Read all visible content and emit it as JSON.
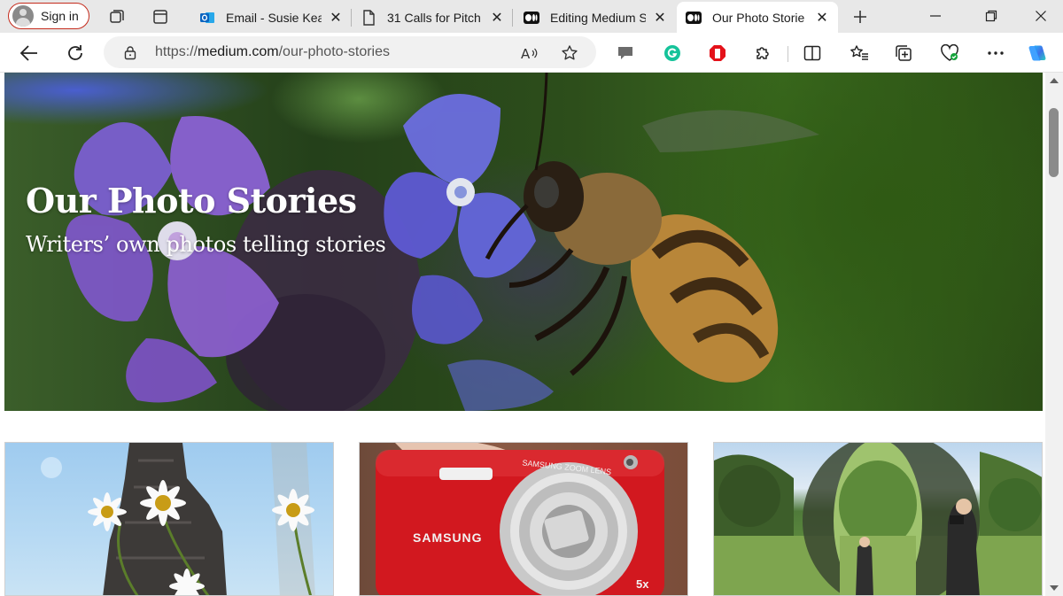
{
  "browser": {
    "profile": {
      "label": "Sign in"
    },
    "tabs": [
      {
        "title": "Email - Susie Kea",
        "icon": "outlook-icon"
      },
      {
        "title": "31 Calls for Pitch",
        "icon": "document-icon"
      },
      {
        "title": "Editing Medium S",
        "icon": "medium-icon"
      },
      {
        "title": "Our Photo Storie",
        "icon": "medium-icon",
        "active": true
      }
    ],
    "address": {
      "scheme": "https://",
      "host": "medium.com",
      "path": "/our-photo-stories"
    },
    "accent": "#c42b1c"
  },
  "page": {
    "hero": {
      "title": "Our Photo Stories",
      "subtitle": "Writers’ own photos telling stories"
    },
    "cards": [
      {
        "subject": "daisies-under-tower"
      },
      {
        "subject": "red-camera",
        "brand": "SAMSUNG",
        "lens_text": "SAMSUNG ZOOM LENS",
        "zoom": "5x"
      },
      {
        "subject": "mirror-sculpture-park"
      }
    ]
  }
}
